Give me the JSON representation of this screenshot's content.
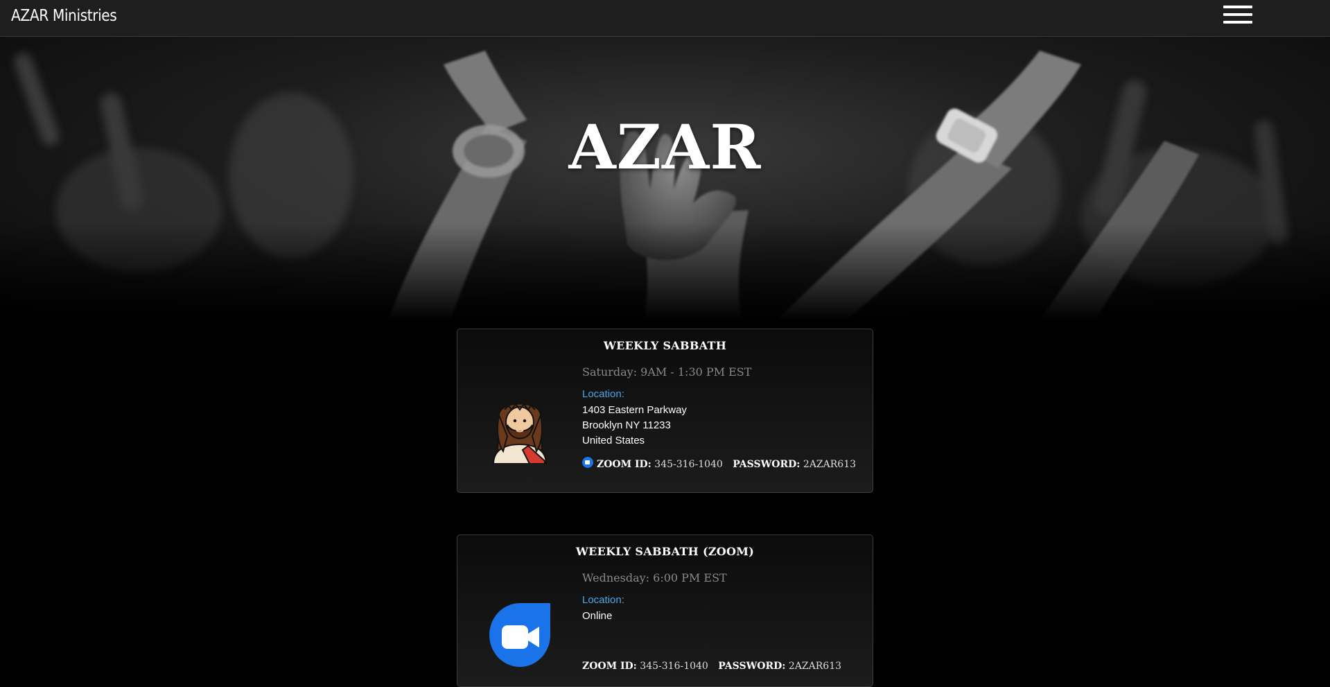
{
  "nav": {
    "brand": "AZAR Ministries",
    "menu_icon": "hamburger-menu-icon"
  },
  "hero": {
    "title": "AZAR"
  },
  "services": [
    {
      "title": "WEEKLY SABBATH",
      "time": "Saturday: 9AM - 1:30 PM EST",
      "location_label": "Location:",
      "location_lines": [
        "1403 Eastern Parkway",
        "Brooklyn NY 11233",
        "United States"
      ],
      "zoom_id_label": "ZOOM ID:",
      "zoom_id": "345-316-1040",
      "password_label": "PASSWORD:",
      "password": "2AZAR613",
      "icon": "jesus-avatar-icon"
    },
    {
      "title": "WEEKLY SABBATH (ZOOM)",
      "time": "Wednesday: 6:00 PM EST",
      "location_label": "Location:",
      "location_lines": [
        "Online"
      ],
      "zoom_id_label": "ZOOM ID:",
      "zoom_id": "345-316-1040",
      "password_label": "PASSWORD:",
      "password": "2AZAR613",
      "icon": "zoom-video-icon"
    }
  ],
  "colors": {
    "navbar": "#1e1e1e",
    "background": "#000000",
    "location_label": "#4aa8e8",
    "zoom_blue": "#1a73e8",
    "time_text": "#8a8a8a"
  }
}
